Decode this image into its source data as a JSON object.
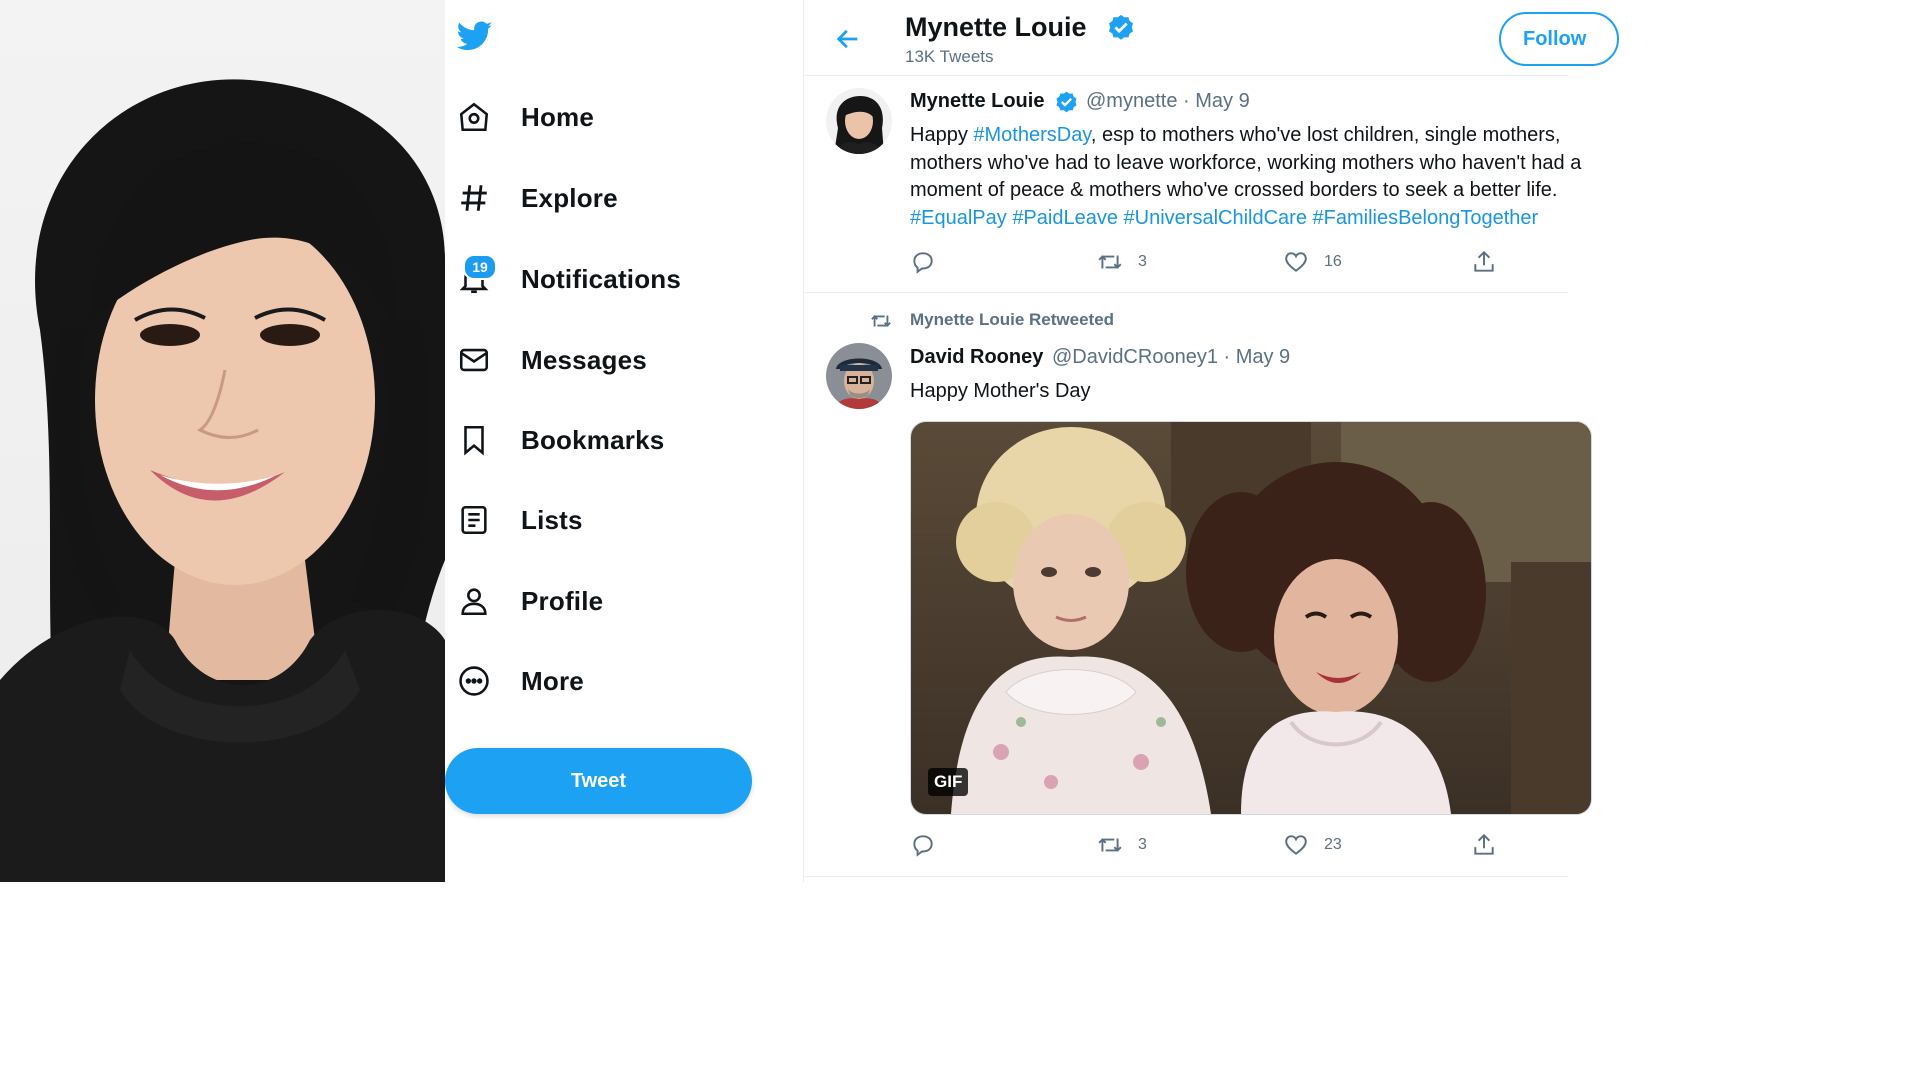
{
  "colors": {
    "accent": "#1da1f2",
    "text": "#0f1419",
    "secondary": "#5b7083",
    "border": "#e6ecf0"
  },
  "sidebar": {
    "items": [
      {
        "label": "Home",
        "icon": "home-icon"
      },
      {
        "label": "Explore",
        "icon": "hashtag-icon"
      },
      {
        "label": "Notifications",
        "icon": "bell-icon",
        "badge": "19"
      },
      {
        "label": "Messages",
        "icon": "envelope-icon"
      },
      {
        "label": "Bookmarks",
        "icon": "bookmark-icon"
      },
      {
        "label": "Lists",
        "icon": "list-icon"
      },
      {
        "label": "Profile",
        "icon": "person-icon"
      },
      {
        "label": "More",
        "icon": "more-icon"
      }
    ],
    "tweet_button": "Tweet"
  },
  "header": {
    "name": "Mynette Louie",
    "tweet_count": "13K Tweets",
    "follow_label": "Follow"
  },
  "tweets": [
    {
      "name": "Mynette Louie",
      "handle": "@mynette",
      "date": "May 9",
      "text_plain_1": "Happy ",
      "hashtag_1": "#MothersDay",
      "text_plain_2": ", esp to mothers who've lost children, single mothers,",
      "line_2": "mothers who've had to leave workforce, working mothers who haven't had a",
      "line_3": "moment of peace & mothers who've crossed borders to seek a better life.",
      "hashtags": [
        "#EqualPay",
        "#PaidLeave",
        "#UniversalChildCare",
        "#FamiliesBelongTogether"
      ],
      "retweets": "3",
      "likes": "16"
    },
    {
      "retweeted_by": "Mynette Louie Retweeted",
      "name": "David Rooney",
      "handle": "@DavidCRooney1",
      "date": "May 9",
      "text": "Happy Mother's Day",
      "media_tag": "GIF",
      "retweets": "3",
      "likes": "23"
    }
  ]
}
